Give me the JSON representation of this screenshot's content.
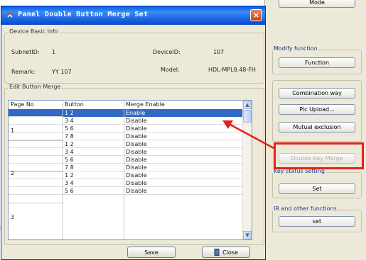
{
  "left_fragment": "s.",
  "bg_panel": {
    "top_button": "Mode",
    "modify_group": {
      "title": "Modify function",
      "function_button": "Function"
    },
    "tools": {
      "combination_button": "Combination way",
      "pic_upload_button": "Pic Upload...",
      "mutual_exclusion_button": "Mutual exclusion",
      "double_key_merge_button": "Double Key Merge"
    },
    "key_status": {
      "title": "Key status setting",
      "set_button": "Set"
    },
    "ir_group": {
      "title": "IR and other functions",
      "set_button": "set"
    }
  },
  "dialog": {
    "title": "Panel Double Button Merge Set",
    "close_glyph": "×",
    "device_info": {
      "legend": "Device Basic Info",
      "subnet_label": "SubnetID:",
      "subnet_value": "1",
      "device_label": "DeviceID:",
      "device_value": "107",
      "remark_label": "Remark:",
      "remark_value": "YY 107",
      "model_label": "Model:",
      "model_value": "HDL-MPL8.48-FH"
    },
    "edit_merge": {
      "legend": "Edit Button Merge",
      "columns": [
        "Page No",
        "Button",
        "Merge Enable"
      ],
      "rows": [
        {
          "page": "1",
          "button": "1  2",
          "merge": "Enable"
        },
        {
          "page": "1",
          "button": "3  4",
          "merge": "Disable"
        },
        {
          "page": "1",
          "button": "5  6",
          "merge": "Disable"
        },
        {
          "page": "1",
          "button": "7  8",
          "merge": "Disable"
        },
        {
          "page": "2",
          "button": "1  2",
          "merge": "Disable"
        },
        {
          "page": "2",
          "button": "3  4",
          "merge": "Disable"
        },
        {
          "page": "2",
          "button": "5  6",
          "merge": "Disable"
        },
        {
          "page": "2",
          "button": "7  8",
          "merge": "Disable"
        },
        {
          "page": "3",
          "button": "1  2",
          "merge": "Disable"
        },
        {
          "page": "3",
          "button": "3  4",
          "merge": "Disable"
        },
        {
          "page": "3",
          "button": "5  6",
          "merge": "Disable"
        }
      ],
      "page_labels": [
        "1",
        "2",
        "3"
      ],
      "scroll_up_glyph": "▲",
      "scroll_down_glyph": "▼"
    },
    "save_button": "Save",
    "close_button": "Close"
  },
  "colors": {
    "title_blue": "#1c64e0",
    "selection": "#316ac5",
    "annotation_red": "#e5211d"
  }
}
